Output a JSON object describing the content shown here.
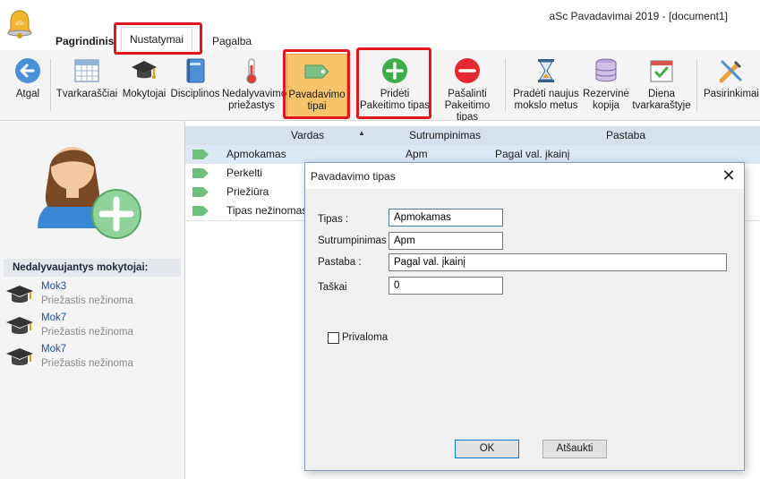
{
  "window": {
    "title": "aSc Pavadavimai 2019  - [document1]"
  },
  "tabs": {
    "home": "Pagrindinis",
    "settings": "Nustatymai",
    "help": "Pagalba"
  },
  "ribbon": {
    "back": "Atgal",
    "timetables": "Tvarkaraščiai",
    "teachers": "Mokytojai",
    "disciplines": "Disciplinos",
    "absence_reasons_l1": "Nedalyvavimo",
    "absence_reasons_l2": "priežastys",
    "substitution_types_l1": "Pavadavimo",
    "substitution_types_l2": "tipai",
    "add_type_l1": "Pridėti",
    "add_type_l2": "Pakeitimo tipas",
    "remove_type_l1": "Pašalinti",
    "remove_type_l2": "Pakeitimo tipas",
    "new_year_l1": "Pradėti naujus",
    "new_year_l2": "mokslo metus",
    "backup_l1": "Rezervinė",
    "backup_l2": "kopija",
    "day_schedule_l1": "Diena",
    "day_schedule_l2": "tvarkaraštyje",
    "options": "Pasirinkimai"
  },
  "left_panel": {
    "absent_header": "Nedalyvaujantys mokytojai:",
    "absent": [
      {
        "name": "Mok3",
        "reason": "Priežastis nežinoma"
      },
      {
        "name": "Mok7",
        "reason": "Priežastis nežinoma"
      },
      {
        "name": "Mok7",
        "reason": "Priežastis nežinoma"
      }
    ]
  },
  "table": {
    "headers": {
      "name": "Vardas",
      "abbr": "Sutrumpinimas",
      "note": "Pastaba"
    },
    "rows": [
      {
        "name": "Apmokamas",
        "abbr": "Apm",
        "note": "Pagal val. įkainį"
      },
      {
        "name": "Perkelti",
        "abbr": "",
        "note": ""
      },
      {
        "name": "Priežiūra",
        "abbr": "",
        "note": ""
      },
      {
        "name": "Tipas nežinomas",
        "abbr": "",
        "note": ""
      }
    ]
  },
  "dialog": {
    "title": "Pavadavimo tipas",
    "labels": {
      "type": "Tipas :",
      "abbr": "Sutrumpinimas",
      "note": "Pastaba :",
      "points": "Taškai",
      "required": "Privaloma"
    },
    "values": {
      "type": "Apmokamas",
      "abbr": "Apm",
      "note": "Pagal val. įkainį",
      "points": "0"
    },
    "required_checked": false,
    "ok": "OK",
    "cancel": "Atšaukti"
  },
  "colors": {
    "highlight": "#e0161d",
    "selected_ribbon": "#f7c46c",
    "header_bg": "#d7e1ec",
    "tag_green": "#6cc07a"
  }
}
